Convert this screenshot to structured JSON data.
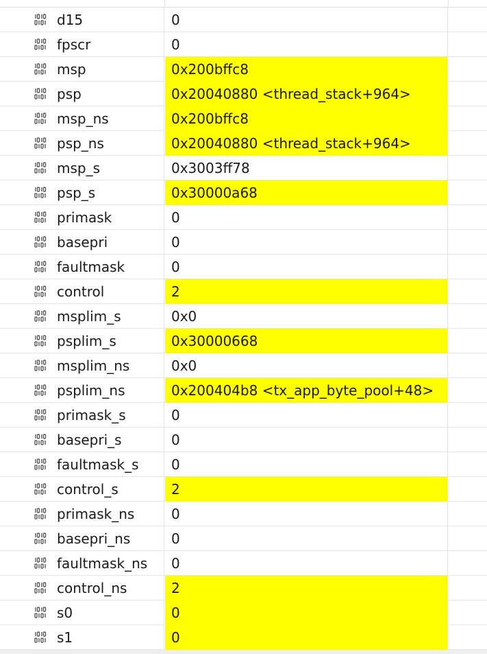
{
  "registers": [
    {
      "name": "d15",
      "value": "0",
      "highlighted": false
    },
    {
      "name": "fpscr",
      "value": "0",
      "highlighted": false
    },
    {
      "name": "msp",
      "value": "0x200bffc8",
      "highlighted": true
    },
    {
      "name": "psp",
      "value": "0x20040880 <thread_stack+964>",
      "highlighted": true
    },
    {
      "name": "msp_ns",
      "value": "0x200bffc8",
      "highlighted": true
    },
    {
      "name": "psp_ns",
      "value": "0x20040880 <thread_stack+964>",
      "highlighted": true
    },
    {
      "name": "msp_s",
      "value": "0x3003ff78",
      "highlighted": false
    },
    {
      "name": "psp_s",
      "value": "0x30000a68",
      "highlighted": true
    },
    {
      "name": "primask",
      "value": "0",
      "highlighted": false
    },
    {
      "name": "basepri",
      "value": "0",
      "highlighted": false
    },
    {
      "name": "faultmask",
      "value": "0",
      "highlighted": false
    },
    {
      "name": "control",
      "value": "2",
      "highlighted": true
    },
    {
      "name": "msplim_s",
      "value": "0x0",
      "highlighted": false
    },
    {
      "name": "psplim_s",
      "value": "0x30000668",
      "highlighted": true
    },
    {
      "name": "msplim_ns",
      "value": "0x0",
      "highlighted": false
    },
    {
      "name": "psplim_ns",
      "value": "0x200404b8 <tx_app_byte_pool+48>",
      "highlighted": true
    },
    {
      "name": "primask_s",
      "value": "0",
      "highlighted": false
    },
    {
      "name": "basepri_s",
      "value": "0",
      "highlighted": false
    },
    {
      "name": "faultmask_s",
      "value": "0",
      "highlighted": false
    },
    {
      "name": "control_s",
      "value": "2",
      "highlighted": true
    },
    {
      "name": "primask_ns",
      "value": "0",
      "highlighted": false
    },
    {
      "name": "basepri_ns",
      "value": "0",
      "highlighted": false
    },
    {
      "name": "faultmask_ns",
      "value": "0",
      "highlighted": false
    },
    {
      "name": "control_ns",
      "value": "2",
      "highlighted": true
    },
    {
      "name": "s0",
      "value": "0",
      "highlighted": true
    },
    {
      "name": "s1",
      "value": "0",
      "highlighted": true
    }
  ],
  "icon": "register-binary-icon",
  "colors": {
    "changed_highlight": "#ffff00",
    "grid_line": "#e4e4e4",
    "text": "#1a1a1a"
  }
}
